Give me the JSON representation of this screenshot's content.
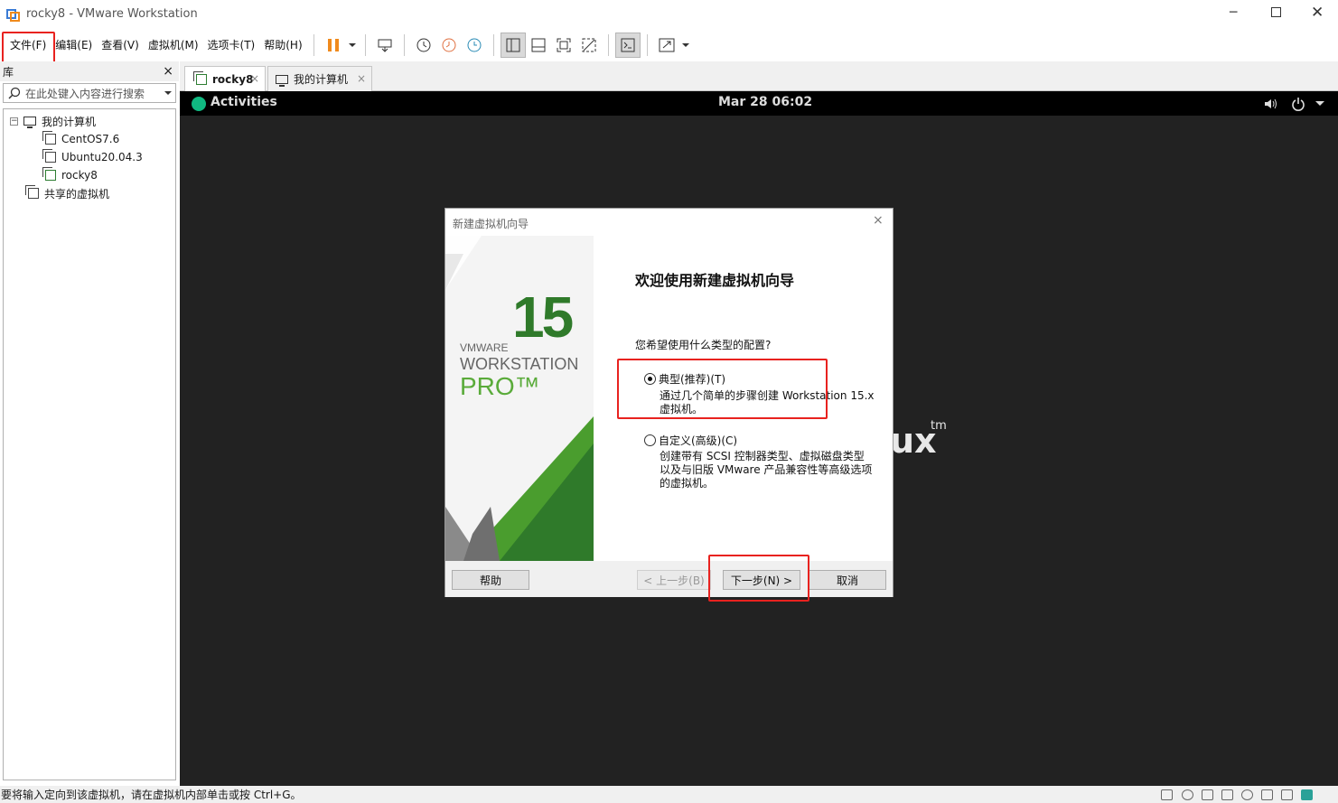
{
  "window": {
    "title": "rocky8 - VMware Workstation"
  },
  "menu": [
    "文件(F)",
    "编辑(E)",
    "查看(V)",
    "虚拟机(M)",
    "选项卡(T)",
    "帮助(H)"
  ],
  "library": {
    "header": "库",
    "close": "×",
    "search_placeholder": "在此处键入内容进行搜索",
    "tree": [
      {
        "label": "我的计算机"
      },
      {
        "label": "CentOS7.6"
      },
      {
        "label": "Ubuntu20.04.3"
      },
      {
        "label": "rocky8"
      },
      {
        "label": "共享的虚拟机"
      }
    ]
  },
  "tabs": [
    {
      "label": "rocky8",
      "close": "×"
    },
    {
      "label": "我的计算机",
      "close": "×"
    }
  ],
  "gnome": {
    "activities": "Activities",
    "clock": "Mar 28  06:02"
  },
  "background_text": {
    "ux": "ux",
    "tm": "tm"
  },
  "wizard": {
    "title": "新建虚拟机向导",
    "close": "×",
    "banner": {
      "number": "15",
      "vmware": "VMWARE",
      "workstation": "WORKSTATION",
      "pro": "PRO™"
    },
    "heading": "欢迎使用新建虚拟机向导",
    "question": "您希望使用什么类型的配置?",
    "options": [
      {
        "label": "典型(推荐)(T)",
        "selected": true,
        "desc": [
          "通过几个简单的步骤创建 Workstation 15.x",
          "虚拟机。"
        ]
      },
      {
        "label": "自定义(高级)(C)",
        "selected": false,
        "desc": [
          "创建带有 SCSI 控制器类型、虚拟磁盘类型",
          "以及与旧版 VMware 产品兼容性等高级选项",
          "的虚拟机。"
        ]
      }
    ],
    "buttons": {
      "help": "帮助",
      "back": "< 上一步(B)",
      "next": "下一步(N) >",
      "cancel": "取消"
    }
  },
  "status": {
    "message": "要将输入定向到该虚拟机，请在虚拟机内部单击或按 Ctrl+G。"
  },
  "colors": {
    "highlight": "#e8221f",
    "pause": "#f08a1c",
    "vmware_green": "#2f7a2a",
    "vmware_light_green": "#5aab3a"
  }
}
